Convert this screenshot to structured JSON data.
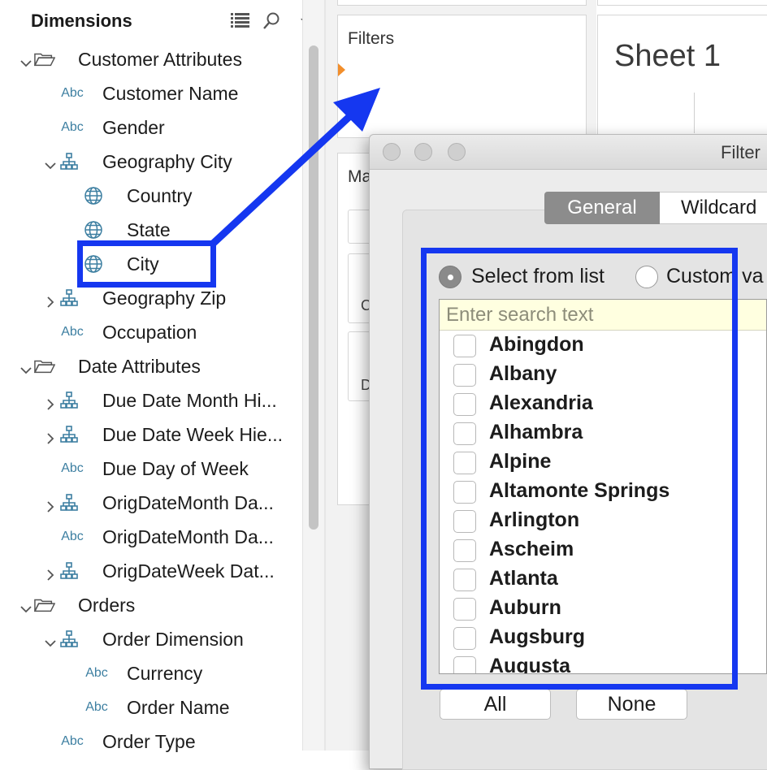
{
  "data_pane": {
    "header": "Dimensions",
    "header_icons": [
      "list-view-icon",
      "search-icon",
      "dropdown-caret-icon"
    ],
    "tree": [
      {
        "label": "Customer Attributes",
        "icon": "folder-open-icon",
        "expanded": true
      },
      {
        "label": "Customer Name",
        "icon": "abc-text-icon",
        "abc": "Abc"
      },
      {
        "label": "Gender",
        "icon": "abc-text-icon",
        "abc": "Abc"
      },
      {
        "label": "Geography City",
        "icon": "hierarchy-icon",
        "expanded": true
      },
      {
        "label": "Country",
        "icon": "globe-icon"
      },
      {
        "label": "State",
        "icon": "globe-icon"
      },
      {
        "label": "City",
        "icon": "globe-icon"
      },
      {
        "label": "Geography Zip",
        "icon": "hierarchy-icon",
        "expanded": false
      },
      {
        "label": "Occupation",
        "icon": "abc-text-icon",
        "abc": "Abc"
      },
      {
        "label": "Date Attributes",
        "icon": "folder-open-icon",
        "expanded": true
      },
      {
        "label": "Due Date Month Hi...",
        "icon": "hierarchy-icon",
        "expanded": false
      },
      {
        "label": "Due Date Week Hie...",
        "icon": "hierarchy-icon",
        "expanded": false
      },
      {
        "label": "Due Day of Week",
        "icon": "abc-text-icon",
        "abc": "Abc"
      },
      {
        "label": "OrigDateMonth Da...",
        "icon": "hierarchy-icon",
        "expanded": false
      },
      {
        "label": "OrigDateMonth Da...",
        "icon": "abc-text-icon",
        "abc": "Abc"
      },
      {
        "label": "OrigDateWeek Dat...",
        "icon": "hierarchy-icon",
        "expanded": false
      },
      {
        "label": "Orders",
        "icon": "folder-open-icon",
        "expanded": true
      },
      {
        "label": "Order Dimension",
        "icon": "hierarchy-icon",
        "expanded": true
      },
      {
        "label": "Currency",
        "icon": "abc-text-icon",
        "abc": "Abc"
      },
      {
        "label": "Order Name",
        "icon": "abc-text-icon",
        "abc": "Abc"
      },
      {
        "label": "Order Type",
        "icon": "abc-text-icon",
        "abc": "Abc"
      }
    ]
  },
  "shelves": {
    "filters_label": "Filters",
    "marks_label_partial": "Ma",
    "marks_row_partial_1": "C",
    "marks_row_partial_2": "D",
    "marker_color": "#f28e2b"
  },
  "sheet": {
    "title": "Sheet 1"
  },
  "dialog": {
    "title_partial": "Filter",
    "tabs": [
      {
        "label": "General",
        "selected": true
      },
      {
        "label": "Wildcard",
        "selected": false
      }
    ],
    "mode_select_from_list": "Select from list",
    "mode_custom_partial": "Custom va",
    "search_placeholder": "Enter search text",
    "search_value": "",
    "values": [
      "Abingdon",
      "Albany",
      "Alexandria",
      "Alhambra",
      "Alpine",
      "Altamonte Springs",
      "Arlington",
      "Ascheim",
      "Atlanta",
      "Auburn",
      "Augsburg",
      "Augusta"
    ],
    "btn_all": "All",
    "btn_none": "None"
  },
  "annotation_color": "#1537f0"
}
